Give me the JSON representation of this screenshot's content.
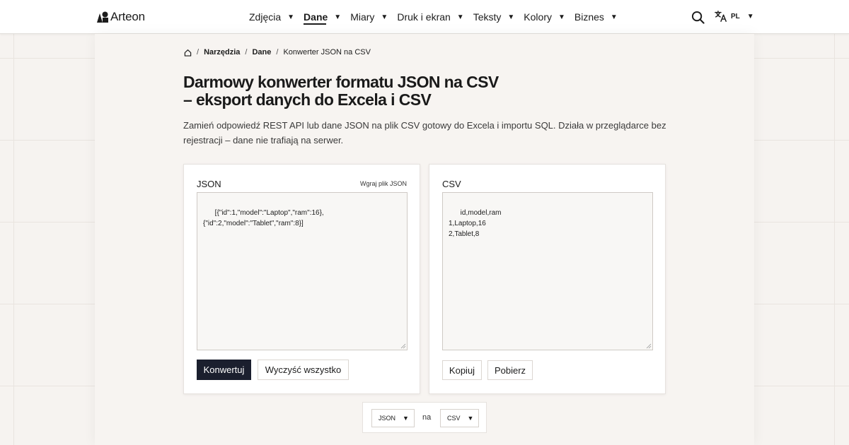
{
  "brand": {
    "name": "Arteon",
    "logo_icon": "arteon-logo-icon"
  },
  "nav": {
    "items": [
      {
        "label": "Zdjęcia",
        "active": false
      },
      {
        "label": "Dane",
        "active": true
      },
      {
        "label": "Miary",
        "active": false
      },
      {
        "label": "Druk i ekran",
        "active": false
      },
      {
        "label": "Teksty",
        "active": false
      },
      {
        "label": "Kolory",
        "active": false
      },
      {
        "label": "Biznes",
        "active": false
      }
    ],
    "caret": "▼"
  },
  "header": {
    "search_icon": "search-icon",
    "language_icon": "translate-icon",
    "language_code": "PL"
  },
  "breadcrumb": {
    "home_icon": "home-icon",
    "items": [
      "Narzędzia",
      "Dane",
      "Konwerter JSON na CSV"
    ],
    "separator": "/"
  },
  "page": {
    "title": "Darmowy konwerter formatu JSON na CSV – eksport danych do Excela i CSV",
    "description": "Zamień odpowiedź REST API lub dane JSON na plik CSV gotowy do Excela i importu SQL. Działa w przeglądarce bez rejestracji – dane nie trafiają na serwer."
  },
  "json_panel": {
    "title": "JSON",
    "upload_label": "Wgraj plik JSON",
    "content": "[{\"id\":1,\"model\":\"Laptop\",\"ram\":16},\n{\"id\":2,\"model\":\"Tablet\",\"ram\":8}]",
    "convert_label": "Konwertuj",
    "clear_label": "Wyczyść wszystko"
  },
  "csv_panel": {
    "title": "CSV",
    "content": "id,model,ram\n1,Laptop,16\n2,Tablet,8",
    "copy_label": "Kopiuj",
    "download_label": "Pobierz"
  },
  "format": {
    "from": "JSON",
    "separator": "na",
    "to": "CSV"
  },
  "colors": {
    "accent": "#1b1f2e",
    "background": "#f6f3f0",
    "surface": "#ffffff"
  }
}
